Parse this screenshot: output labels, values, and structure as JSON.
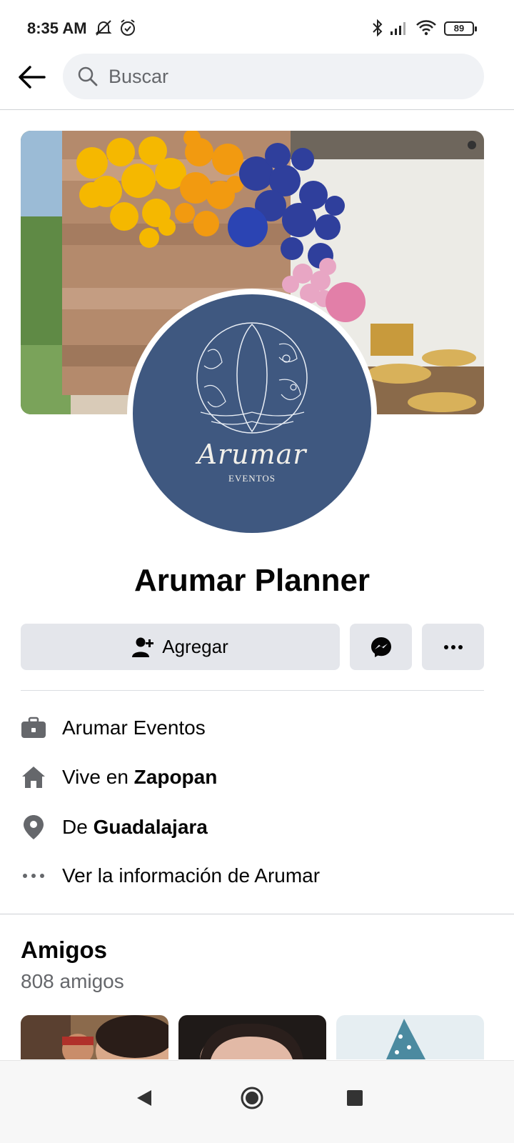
{
  "status_bar": {
    "time": "8:35 AM",
    "battery": "89",
    "icons": [
      "mute-icon",
      "alarm-icon",
      "bluetooth-icon",
      "signal-icon",
      "wifi-icon",
      "battery-icon"
    ]
  },
  "search": {
    "placeholder": "Buscar"
  },
  "profile": {
    "name": "Arumar Planner",
    "logo_text": "Arumar",
    "logo_subtext": "EVENTOS"
  },
  "actions": {
    "add_label": "Agregar"
  },
  "details": {
    "work": "Arumar Eventos",
    "lives_prefix": "Vive en ",
    "lives_place": "Zapopan",
    "from_prefix": "De ",
    "from_place": "Guadalajara",
    "more_info": "Ver la información de Arumar"
  },
  "friends": {
    "title": "Amigos",
    "count": "808 amigos"
  },
  "colors": {
    "accent": "#1877f2",
    "button_bg": "#e4e6eb",
    "avatar_bg": "#3f5880"
  }
}
